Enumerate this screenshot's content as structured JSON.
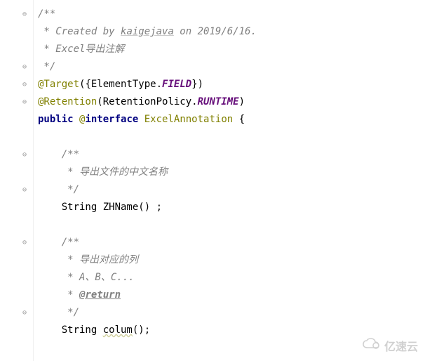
{
  "code": {
    "line1": "/**",
    "line2_prefix": " * Created by ",
    "line2_author": "kaigejava",
    "line2_suffix": " on 2019/6/16.",
    "line3": " * Excel导出注解",
    "line4": " */",
    "line5_annotation": "@Target",
    "line5_paren_open": "({",
    "line5_class": "ElementType.",
    "line5_field": "FIELD",
    "line5_paren_close": "})",
    "line6_annotation": "@Retention",
    "line6_paren_open": "(",
    "line6_class": "RetentionPolicy.",
    "line6_field": "RUNTIME",
    "line6_paren_close": ")",
    "line7_kw1": "public ",
    "line7_at": "@",
    "line7_kw2": "interface ",
    "line7_name": "ExcelAnnotation",
    "line7_brace": " {",
    "line8": "",
    "line9": "    /**",
    "line10": "     * 导出文件的中文名称",
    "line11": "     */",
    "line12_type": "    String ",
    "line12_method": "ZHName",
    "line12_suffix": "() ;",
    "line13": "",
    "line14": "    /**",
    "line15": "     * 导出对应的列",
    "line16": "     * A、B、C...",
    "line17_prefix": "     * ",
    "line17_tag": "@return",
    "line18": "     */",
    "line19_type": "    String ",
    "line19_method": "colum",
    "line19_suffix": "();"
  },
  "watermark": {
    "text": "亿速云"
  }
}
